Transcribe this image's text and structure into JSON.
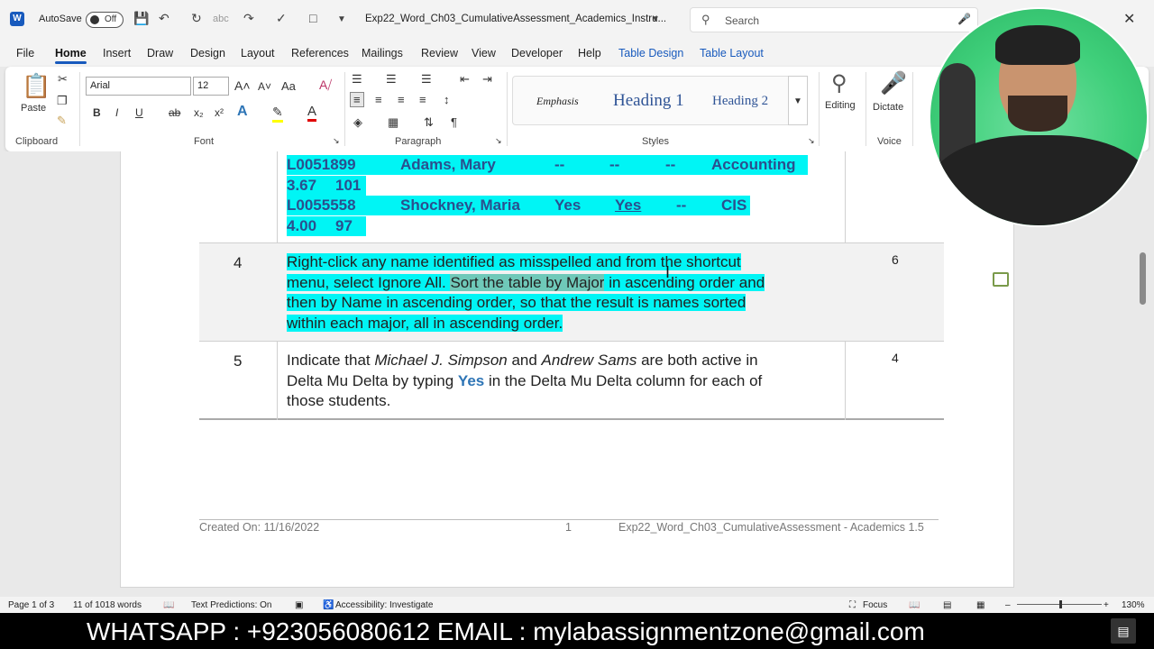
{
  "titlebar": {
    "autosave_label": "AutoSave",
    "autosave_state": "Off",
    "document_title": "Exp22_Word_Ch03_CumulativeAssessment_Academics_Instru...",
    "search_placeholder": "Search"
  },
  "menu": {
    "items": [
      "File",
      "Home",
      "Insert",
      "Draw",
      "Design",
      "Layout",
      "References",
      "Mailings",
      "Review",
      "View",
      "Developer",
      "Help",
      "Table Design",
      "Table Layout"
    ],
    "active": "Home"
  },
  "ribbon": {
    "clipboard": {
      "paste_label": "Paste",
      "group_label": "Clipboard"
    },
    "font": {
      "font_name": "Arial",
      "font_size": "12",
      "case_label": "Aa",
      "group_label": "Font"
    },
    "paragraph": {
      "group_label": "Paragraph"
    },
    "styles": {
      "items": [
        "Emphasis",
        "Heading 1",
        "Heading 2"
      ],
      "group_label": "Styles"
    },
    "editing": {
      "label": "Editing"
    },
    "voice": {
      "dictate_label": "Dictate",
      "group_label": "Voice"
    }
  },
  "document": {
    "top_rows": [
      {
        "id": "L0051899",
        "name": "Adams, Mary",
        "c1": "--",
        "c2": "--",
        "c3": "--",
        "major": "Accounting"
      },
      {
        "gpa": "3.67",
        "credits": "101"
      },
      {
        "id": "L0055558",
        "name": "Shockney, Maria",
        "c1": "Yes",
        "c2": "Yes",
        "c3": "--",
        "major": "CIS"
      },
      {
        "gpa": "4.00",
        "credits": "97"
      }
    ],
    "steps": [
      {
        "number": "4",
        "points": "6",
        "lines": [
          "Right-click any name identified as misspelled and from the shortcut",
          "menu, select Ignore All. ",
          "Sort the table by Major",
          " in ascending order and",
          "then by Name in ascending order, so that the result is names sorted",
          "within each major, all in ascending order."
        ]
      },
      {
        "number": "5",
        "points": "4",
        "text_a": "Indicate that ",
        "name1": "Michael J. Simpson",
        "text_b": " and ",
        "name2": "Andrew Sams",
        "text_c": " are both active in",
        "line2_a": "Delta Mu Delta by typing ",
        "yes": "Yes",
        "line2_b": " in the Delta Mu Delta column for each of",
        "line3": "those students."
      }
    ],
    "footer": {
      "created": "Created On: 11/16/2022",
      "page": "1",
      "file": "Exp22_Word_Ch03_CumulativeAssessment - Academics 1.5"
    }
  },
  "statusbar": {
    "page": "Page 1 of 3",
    "words": "11 of 1018 words",
    "predictions": "Text Predictions: On",
    "accessibility": "Accessibility: Investigate",
    "focus": "Focus",
    "zoom": "130%"
  },
  "banner": {
    "text": "WHATSAPP : +923056080612 EMAIL : mylabassignmentzone@gmail.com"
  },
  "colors": {
    "highlight": "#00f5f5",
    "accent": "#185abd",
    "yes_blue": "#2e75b6"
  }
}
